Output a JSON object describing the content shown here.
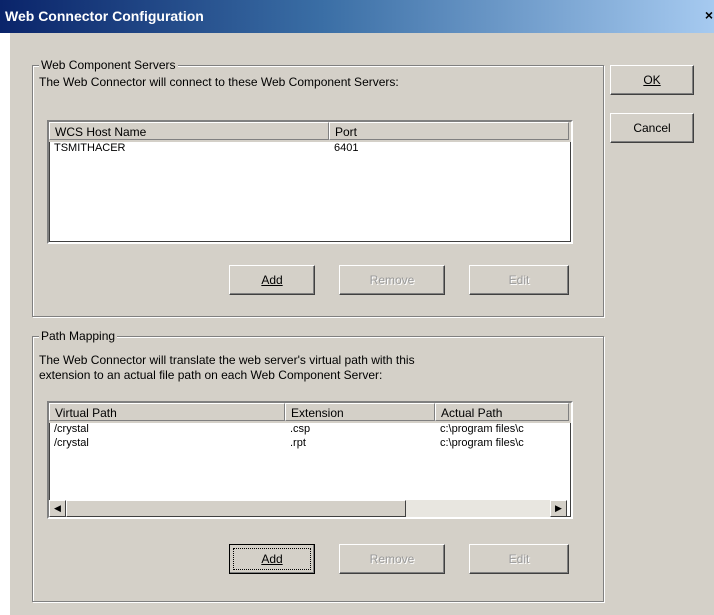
{
  "window": {
    "title": "Web Connector Configuration",
    "close_glyph": "×"
  },
  "buttons": {
    "ok": "OK",
    "cancel": "Cancel"
  },
  "servers": {
    "legend": "Web Component Servers",
    "description": "The Web Connector will connect to these Web Component Servers:",
    "columns": [
      "WCS Host Name",
      "Port"
    ],
    "rows": [
      [
        "TSMITHACER",
        "6401"
      ]
    ],
    "add": "Add",
    "remove": "Remove",
    "edit": "Edit"
  },
  "path_mapping": {
    "legend": "Path Mapping",
    "description_line1": "The Web Connector will translate the web server's virtual path with this",
    "description_line2": "extension to an actual file path on each Web Component Server:",
    "columns": [
      "Virtual Path",
      "Extension",
      "Actual Path"
    ],
    "rows": [
      [
        "/crystal",
        ".csp",
        "c:\\program files\\c"
      ],
      [
        "/crystal",
        ".rpt",
        "c:\\program files\\c"
      ]
    ],
    "add": "Add",
    "remove": "Remove",
    "edit": "Edit"
  }
}
